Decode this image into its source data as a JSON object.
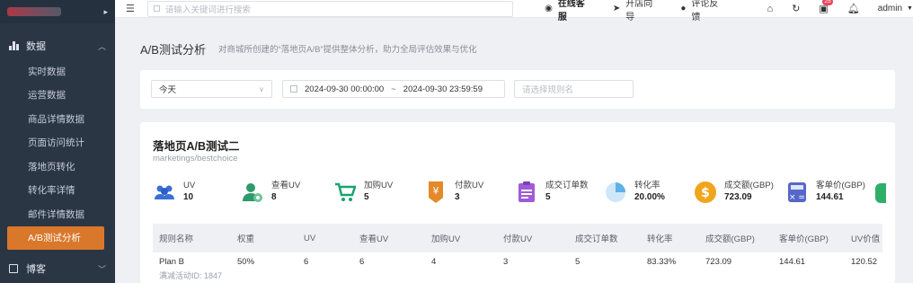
{
  "sidebar": {
    "group_label": "数据",
    "items": [
      {
        "label": "实时数据"
      },
      {
        "label": "运营数据"
      },
      {
        "label": "商品详情数据"
      },
      {
        "label": "页面访问统计"
      },
      {
        "label": "落地页转化"
      },
      {
        "label": "转化率详情"
      },
      {
        "label": "邮件详情数据"
      },
      {
        "label": "A/B测试分析",
        "active": true
      }
    ],
    "bottom_group_label": "博客"
  },
  "topbar": {
    "search_placeholder": "请输入关键词进行搜索",
    "links": [
      {
        "label": "在线客服",
        "icon": "compass-icon"
      },
      {
        "label": "开店向导",
        "icon": "send-icon"
      },
      {
        "label": "评论反馈",
        "icon": "chat-icon"
      }
    ],
    "notification_badge": "25",
    "user": "admin"
  },
  "page": {
    "title": "A/B测试分析",
    "description": "对商城所创建的“落地页A/B”提供整体分析，助力全局评估效果与优化"
  },
  "filters": {
    "period": "今天",
    "date_start": "2024-09-30 00:00:00",
    "date_separator": "~",
    "date_end": "2024-09-30 23:59:59",
    "rule_placeholder": "请选择规则名"
  },
  "test": {
    "title": "落地页A/B测试二",
    "path": "marketings/bestchoice"
  },
  "metrics": [
    {
      "label": "UV",
      "value": "10",
      "icon": "users-icon",
      "color": "#3b6fd8"
    },
    {
      "label": "查看UV",
      "value": "8",
      "icon": "user-view-icon",
      "color": "#2f9a6b"
    },
    {
      "label": "加购UV",
      "value": "5",
      "icon": "cart-icon",
      "color": "#1aa36e"
    },
    {
      "label": "付款UV",
      "value": "3",
      "icon": "payment-icon",
      "color": "#e38a2a"
    },
    {
      "label": "成交订单数",
      "value": "5",
      "icon": "order-list-icon",
      "color": "#a05cd6"
    },
    {
      "label": "转化率",
      "value": "20.00%",
      "icon": "pie-chart-icon",
      "color": "#5fb0e8"
    },
    {
      "label": "成交额(GBP)",
      "value": "723.09",
      "icon": "dollar-coin-icon",
      "color": "#f0a51c"
    },
    {
      "label": "客单价(GBP)",
      "value": "144.61",
      "icon": "calculator-icon",
      "color": "#5568c9"
    }
  ],
  "table": {
    "headers": [
      "规则名称",
      "权重",
      "UV",
      "查看UV",
      "加购UV",
      "付款UV",
      "成交订单数",
      "转化率",
      "成交额(GBP)",
      "客单价(GBP)",
      "UV价值"
    ],
    "rows": [
      {
        "name": "Plan B",
        "sub": "满减活动ID: 1847",
        "cells": [
          "50%",
          "6",
          "6",
          "4",
          "3",
          "5",
          "83.33%",
          "723.09",
          "144.61",
          "120.52"
        ]
      }
    ]
  }
}
